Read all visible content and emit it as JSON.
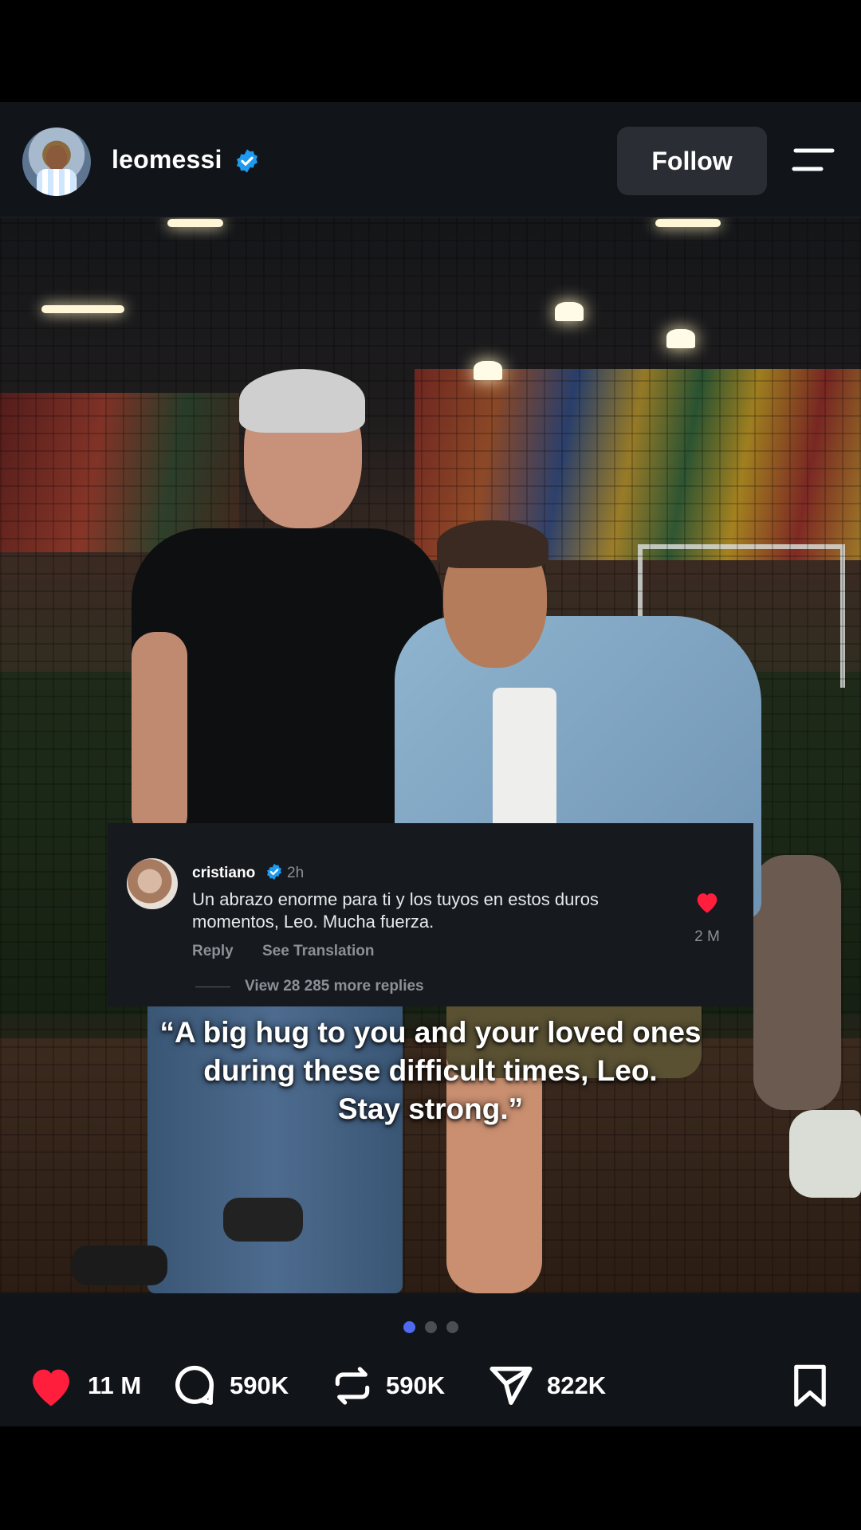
{
  "post": {
    "username": "leomessi",
    "follow_label": "Follow",
    "icons": {
      "verified": "verified-badge-icon",
      "menu": "menu-icon",
      "avatar": "profile-avatar"
    },
    "brand_color": "#1d9bf0",
    "accent_color": "#4f6af0",
    "like_color": "#ff1e3c"
  },
  "comment": {
    "username": "cristiano",
    "time": "2h",
    "text": "Un abrazo enorme para ti y los tuyos en estos duros momentos, Leo. Mucha fuerza.",
    "reply_label": "Reply",
    "translate_label": "See Translation",
    "more_replies": "View 28 285 more replies",
    "likes": "2 M"
  },
  "caption": {
    "line1": "“A big hug to you and your loved ones",
    "line2": "during these difficult times, Leo.",
    "line3": "Stay strong.”"
  },
  "carousel": {
    "total": 3,
    "active": 1
  },
  "actions": {
    "likes": "11 M",
    "comments": "590K",
    "reposts": "590K",
    "shares": "822K"
  }
}
